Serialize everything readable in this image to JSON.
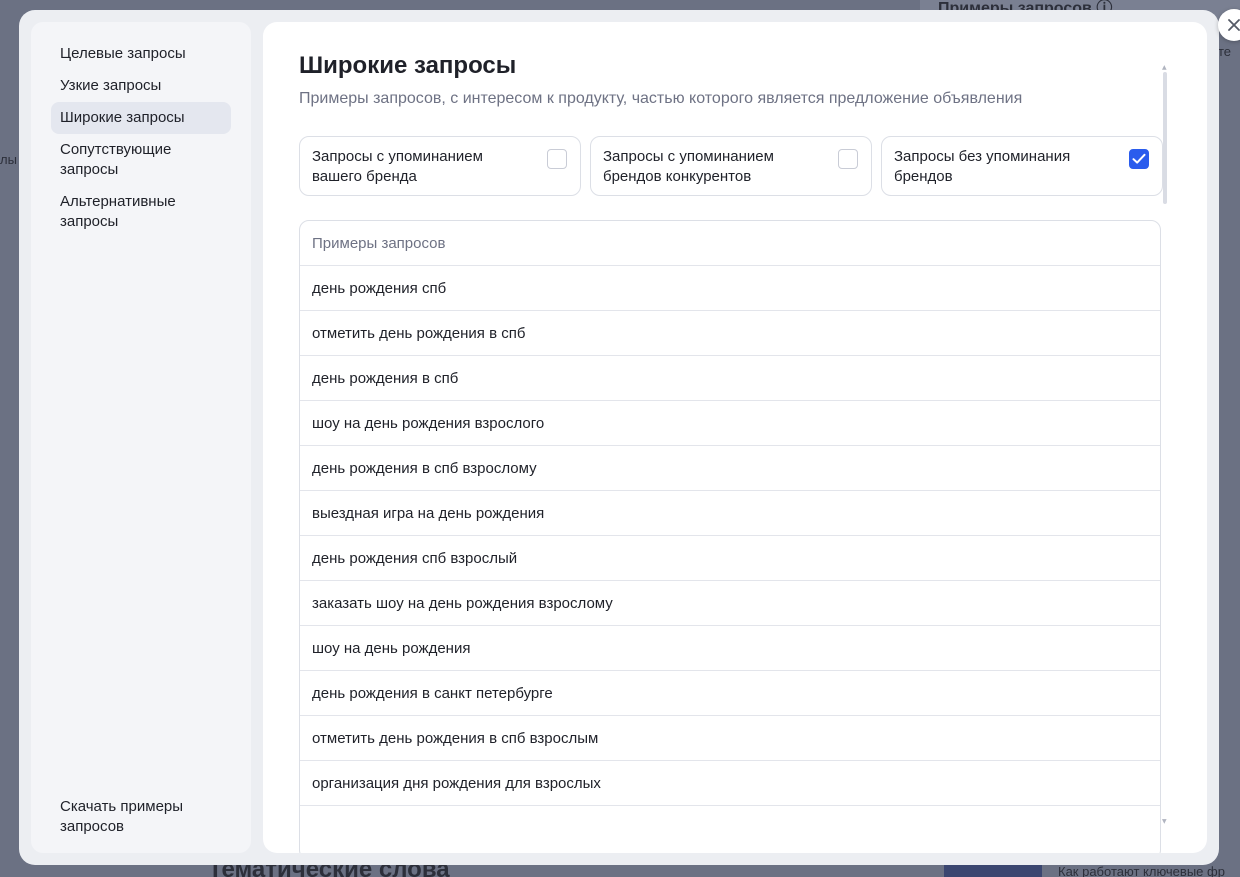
{
  "background": {
    "top_heading": "Примеры запросов ⓘ",
    "right_fragment": "те",
    "left_fragment": "лы",
    "bottom_heading": "Тематические слова",
    "bottom_right_text": "Как работают ключевые фр"
  },
  "sidebar": {
    "items": [
      {
        "label": "Целевые запросы",
        "active": false
      },
      {
        "label": "Узкие запросы",
        "active": false
      },
      {
        "label": "Широкие запросы",
        "active": true
      },
      {
        "label": "Сопутствующие запросы",
        "active": false
      },
      {
        "label": "Альтернативные запросы",
        "active": false
      }
    ],
    "download_label": "Скачать примеры запросов"
  },
  "main": {
    "title": "Широкие запросы",
    "subtitle": "Примеры запросов, с интересом к продукту, частью которого является предложение объявления",
    "filters": [
      {
        "label": "Запросы с упоминанием вашего бренда",
        "checked": false
      },
      {
        "label": "Запросы с упоминанием брендов конкурентов",
        "checked": false
      },
      {
        "label": "Запросы без упоминания брендов",
        "checked": true
      }
    ],
    "table": {
      "header": "Примеры запросов",
      "rows": [
        "день рождения спб",
        "отметить день рождения в спб",
        "день рождения в спб",
        "шоу на день рождения взрослого",
        "день рождения в спб взрослому",
        "выездная игра на день рождения",
        "день рождения спб взрослый",
        "заказать шоу на день рождения взрослому",
        "шоу на день рождения",
        "день рождения в санкт петербурге",
        "отметить день рождения в спб взрослым",
        "организация дня рождения для взрослых"
      ]
    }
  },
  "colors": {
    "accent": "#2a5ced",
    "overlay": "#6b7183"
  },
  "icons": {
    "close": "close-icon",
    "check": "checkmark-icon"
  }
}
